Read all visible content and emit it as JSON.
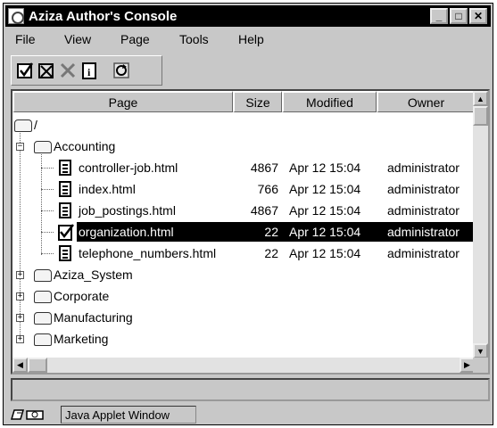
{
  "window": {
    "title": "Aziza Author's Console"
  },
  "menu": [
    "File",
    "View",
    "Page",
    "Tools",
    "Help"
  ],
  "toolbar": {
    "buttons": [
      "checkin-icon",
      "checkout-icon",
      "delete-icon",
      "info-icon",
      "refresh-icon"
    ]
  },
  "columns": [
    "Page",
    "Size",
    "Modified",
    "Owner"
  ],
  "tree": {
    "root_label": "/",
    "folders": [
      "Accounting",
      "Aziza_System",
      "Corporate",
      "Manufacturing",
      "Marketing"
    ],
    "accounting_files": [
      {
        "name": "controller-job.html",
        "size": "4867",
        "modified": "Apr 12 15:04",
        "owner": "administrator"
      },
      {
        "name": "index.html",
        "size": "766",
        "modified": "Apr 12 15:04",
        "owner": "administrator"
      },
      {
        "name": "job_postings.html",
        "size": "4867",
        "modified": "Apr 12 15:04",
        "owner": "administrator"
      },
      {
        "name": "organization.html",
        "size": "22",
        "modified": "Apr 12 15:04",
        "owner": "administrator"
      },
      {
        "name": "telephone_numbers.html",
        "size": "22",
        "modified": "Apr 12 15:04",
        "owner": "administrator"
      }
    ]
  },
  "selected_file": "organization.html",
  "status": {
    "applet_label": "Java Applet Window"
  },
  "colors": {
    "titlebar": "#000000",
    "window_bg": "#c8c8c8",
    "selection": "#000000"
  }
}
